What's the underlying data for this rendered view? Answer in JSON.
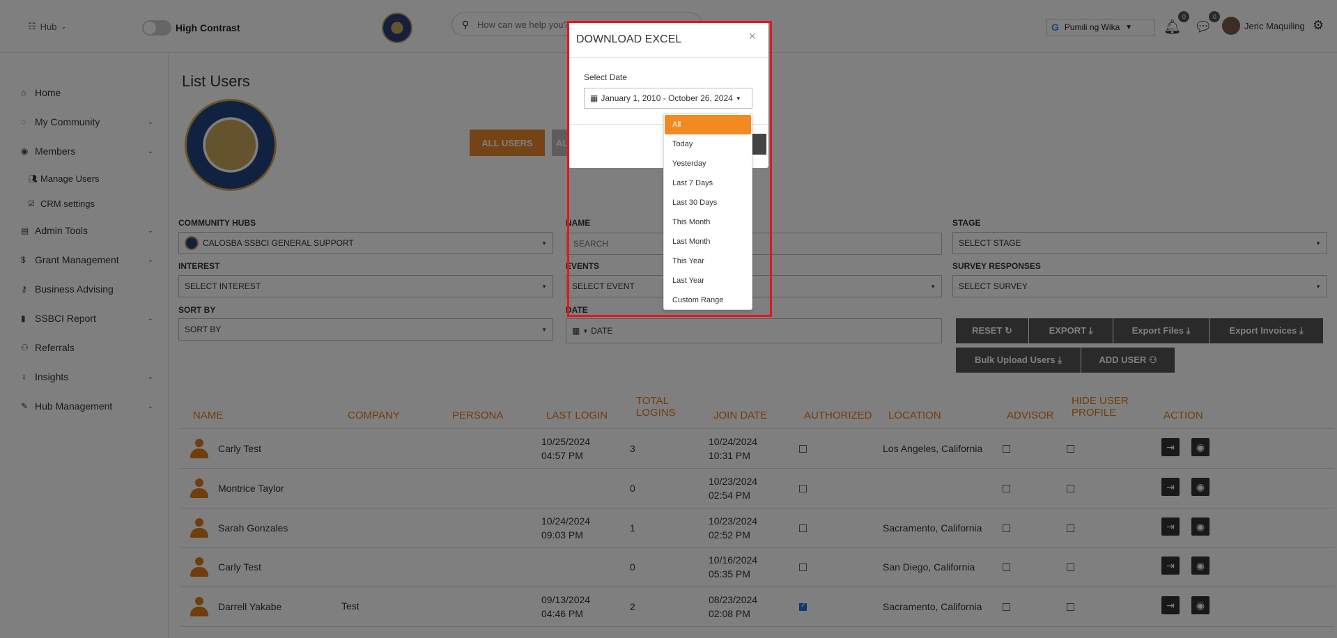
{
  "topbar": {
    "hub_label": "Hub",
    "high_contrast_label": "High Contrast",
    "search_placeholder": "How can we help you?",
    "language_label": "Pumili ng Wika",
    "notifications_count": "0",
    "messages_count": "0",
    "user_name": "Jeric Maquiling"
  },
  "sidebar": {
    "items": [
      {
        "label": "Home"
      },
      {
        "label": "My Community"
      },
      {
        "label": "Members"
      },
      {
        "label": "Manage Users"
      },
      {
        "label": "CRM settings"
      },
      {
        "label": "Admin Tools"
      },
      {
        "label": "Grant Management"
      },
      {
        "label": "Business Advising"
      },
      {
        "label": "SSBCI Report"
      },
      {
        "label": "Referrals"
      },
      {
        "label": "Insights"
      },
      {
        "label": "Hub Management"
      }
    ]
  },
  "main": {
    "title": "List Users",
    "tab_all_users": "ALL USERS",
    "tab_next_partial": "AL",
    "filters": {
      "community_hubs_label": "COMMUNITY HUBS",
      "community_hubs_value": "CALOSBA SSBCI GENERAL SUPPORT",
      "name_label": "NAME",
      "name_placeholder": "SEARCH",
      "stage_label": "STAGE",
      "stage_value": "SELECT STAGE",
      "interest_label": "INTEREST",
      "interest_value": "SELECT INTEREST",
      "events_label": "EVENTS",
      "events_value": "SELECT EVENT",
      "survey_label": "SURVEY RESPONSES",
      "survey_value": "SELECT SURVEY",
      "sort_label": "SORT BY",
      "sort_value": "SORT BY",
      "date_label": "DATE",
      "date_value": "DATE"
    },
    "actions": {
      "reset": "RESET",
      "export": "EXPORT",
      "export_files": "Export Files",
      "export_invoices": "Export Invoices",
      "bulk_upload": "Bulk Upload Users",
      "add_user": "ADD USER"
    },
    "table": {
      "headers": {
        "name": "NAME",
        "company": "COMPANY",
        "persona": "PERSONA",
        "last_login": "LAST LOGIN",
        "total_logins_1": "TOTAL",
        "total_logins_2": "LOGINS",
        "join_date": "JOIN DATE",
        "authorized": "AUTHORIZED",
        "location": "LOCATION",
        "advisor": "ADVISOR",
        "hide_1": "HIDE USER",
        "hide_2": "PROFILE",
        "action": "ACTION"
      },
      "rows": [
        {
          "name": "Carly Test",
          "company": "",
          "last_login_1": "10/25/2024",
          "last_login_2": "04:57 PM",
          "logins": "3",
          "join_1": "10/24/2024",
          "join_2": "10:31 PM",
          "authorized": false,
          "location": "Los Angeles, California"
        },
        {
          "name": "Montrice Taylor",
          "company": "",
          "last_login_1": "",
          "last_login_2": "",
          "logins": "0",
          "join_1": "10/23/2024",
          "join_2": "02:54 PM",
          "authorized": false,
          "location": ""
        },
        {
          "name": "Sarah Gonzales",
          "company": "",
          "last_login_1": "10/24/2024",
          "last_login_2": "09:03 PM",
          "logins": "1",
          "join_1": "10/23/2024",
          "join_2": "02:52 PM",
          "authorized": false,
          "location": "Sacramento, California"
        },
        {
          "name": "Carly Test",
          "company": "",
          "last_login_1": "",
          "last_login_2": "",
          "logins": "0",
          "join_1": "10/16/2024",
          "join_2": "05:35 PM",
          "authorized": false,
          "location": "San Diego, California"
        },
        {
          "name": "Darrell Yakabe",
          "company": "Test",
          "last_login_1": "09/13/2024",
          "last_login_2": "04:46 PM",
          "logins": "2",
          "join_1": "08/23/2024",
          "join_2": "02:08 PM",
          "authorized": true,
          "location": "Sacramento, California"
        }
      ]
    }
  },
  "modal": {
    "title": "DOWNLOAD EXCEL",
    "close": "×",
    "select_date_label": "Select Date",
    "date_range": "January 1, 2010 - October 26, 2024",
    "options": [
      "All",
      "Today",
      "Yesterday",
      "Last 7 Days",
      "Last 30 Days",
      "This Month",
      "Last Month",
      "This Year",
      "Last Year",
      "Custom Range"
    ],
    "selected_option": "All"
  },
  "colors": {
    "accent": "#e07b18",
    "active_option": "#f28a22",
    "highlight": "#e5161e",
    "button_dark": "#555555"
  }
}
